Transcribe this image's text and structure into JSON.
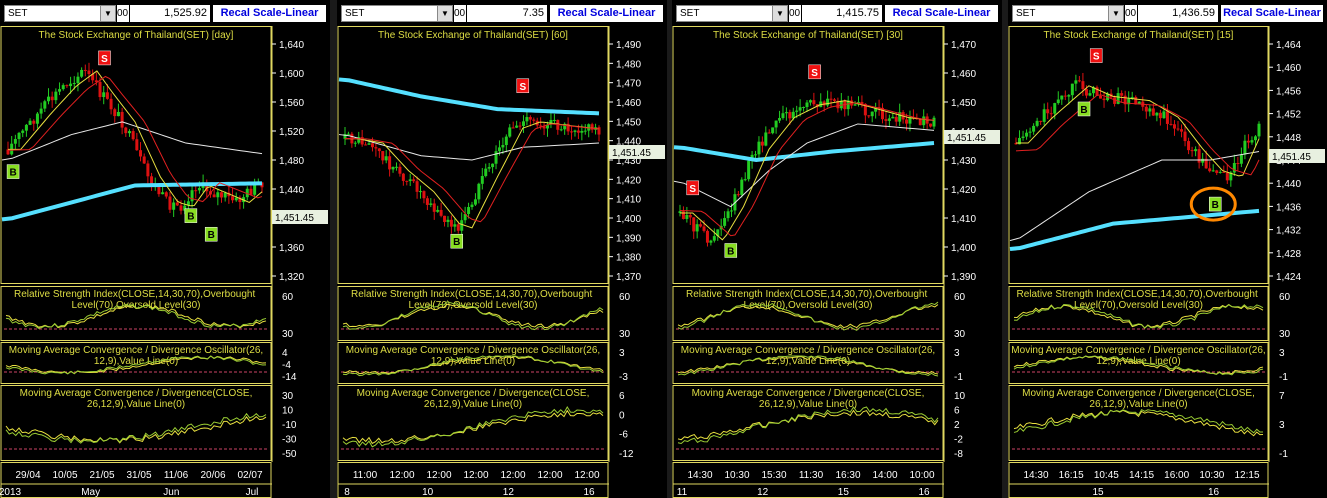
{
  "panels": [
    {
      "symbol": "SET",
      "field_small": "00",
      "price": "1,525.92",
      "scale_label": "Recal Scale-Linear",
      "title": "The Stock Exchange of Thailand(SET) [day]",
      "last_price": "1,451.45",
      "price_ticks": [
        "1,640",
        "1,600",
        "1,560",
        "1,520",
        "1,480",
        "1,440",
        "1,400",
        "1,360",
        "1,320"
      ],
      "rsi_title": "Relative Strength Index(CLOSE,14,30,70),Overbought Level(70),Oversold Level(30)",
      "rsi_ticks": [
        "60",
        "30"
      ],
      "macd_osc_title": "Moving Average Convergence / Divergence Oscillator(26,12,9),Value Line(0)",
      "macd_osc_ticks": [
        "4",
        "-4",
        "-14"
      ],
      "macd_title": "Moving Average Convergence / Divergence(CLOSE,26,12,9),Value Line(0)",
      "macd_ticks": [
        "30",
        "10",
        "-10",
        "-30",
        "-50"
      ],
      "time_labels": [
        "29/04",
        "10/05",
        "21/05",
        "31/05",
        "11/06",
        "20/06",
        "02/07"
      ],
      "bottom_labels": [
        "2013",
        "May",
        "Jun",
        "Jul"
      ],
      "signals": [
        "B",
        "B",
        "S",
        "B"
      ]
    },
    {
      "symbol": "SET",
      "field_small": "00",
      "price": "7.35",
      "scale_label": "Recal Scale-Linear",
      "title": "The Stock Exchange of Thailand(SET) [60]",
      "last_price": "1,451.45",
      "price_ticks": [
        "1,490",
        "1,480",
        "1,470",
        "1,460",
        "1,450",
        "1,440",
        "1,430",
        "1,420",
        "1,410",
        "1,400",
        "1,390",
        "1,380",
        "1,370"
      ],
      "rsi_title": "Relative Strength Index(CLOSE,14,30,70),Overbought Level(70),Oversold Level(30)",
      "rsi_ticks": [
        "60",
        "30"
      ],
      "macd_osc_title": "Moving Average Convergence / Divergence Oscillator(26,12,9),Value Line(0)",
      "macd_osc_ticks": [
        "3",
        "-3"
      ],
      "macd_title": "Moving Average Convergence / Divergence(CLOSE,26,12,9),Value Line(0)",
      "macd_ticks": [
        "6",
        "0",
        "-6",
        "-12"
      ],
      "time_labels": [
        "11:00",
        "12:00",
        "12:00",
        "12:00",
        "12:00",
        "12:00",
        "12:00"
      ],
      "bottom_labels": [
        "8",
        "10",
        "12",
        "16"
      ],
      "signals": [
        "S",
        "B"
      ]
    },
    {
      "symbol": "SET",
      "field_small": "00",
      "price": "1,415.75",
      "scale_label": "Recal Scale-Linear",
      "title": "The Stock Exchange of Thailand(SET) [30]",
      "last_price": "1,451.45",
      "price_ticks": [
        "1,470",
        "1,460",
        "1,450",
        "1,440",
        "1,430",
        "1,420",
        "1,410",
        "1,400",
        "1,390"
      ],
      "rsi_title": "Relative Strength Index(CLOSE,14,30,70),Overbought Level(70),Oversold Level(30)",
      "rsi_ticks": [
        "60",
        "30"
      ],
      "macd_osc_title": "Moving Average Convergence / Divergence Oscillator(26,12,9),Value Line(0)",
      "macd_osc_ticks": [
        "3",
        "-1"
      ],
      "macd_title": "Moving Average Convergence / Divergence(CLOSE,26,12,9),Value Line(0)",
      "macd_ticks": [
        "10",
        "6",
        "2",
        "-2",
        "-8"
      ],
      "time_labels": [
        "14:30",
        "10:30",
        "15:30",
        "11:30",
        "16:30",
        "14:00",
        "10:00"
      ],
      "bottom_labels": [
        "11",
        "12",
        "15",
        "16"
      ],
      "signals": [
        "S",
        "S",
        "B"
      ]
    },
    {
      "symbol": "SET",
      "field_small": "00",
      "price": "1,436.59",
      "scale_label": "Recal Scale-Linear",
      "title": "The Stock Exchange of Thailand(SET) [15]",
      "last_price": "1,451.45",
      "price_ticks": [
        "1,464",
        "1,460",
        "1,456",
        "1,452",
        "1,448",
        "1,444",
        "1,440",
        "1,436",
        "1,432",
        "1,428",
        "1,424"
      ],
      "rsi_title": "Relative Strength Index(CLOSE,14,30,70),Overbought Level(70),Oversold Level(30)",
      "rsi_ticks": [
        "60",
        "30"
      ],
      "macd_osc_title": "Moving Average Convergence / Divergence Oscillator(26,12,9),Value Line(0)",
      "macd_osc_ticks": [
        "3",
        "-1"
      ],
      "macd_title": "Moving Average Convergence / Divergence(CLOSE,26,12,9),Value Line(0)",
      "macd_ticks": [
        "7",
        "3",
        "-1"
      ],
      "time_labels": [
        "14:30",
        "16:15",
        "10:45",
        "14:15",
        "16:00",
        "10:30",
        "12:15"
      ],
      "bottom_labels": [
        "15",
        "16"
      ],
      "signals": [
        "S",
        "B",
        "B"
      ]
    }
  ],
  "colors": {
    "background": "#000000",
    "border": "#e0d860",
    "candle_up": "#22cc22",
    "candle_down": "#dd1111",
    "ma_long": "#55e0ff",
    "ma_white": "#e8e8e8",
    "ma_yellow": "#e8e040",
    "ma_red": "#e02020",
    "buy_signal": "#88dd22",
    "sell_signal": "#ee1111",
    "highlight_circle": "#ff8800",
    "text_title": "#dddd44",
    "text_axis": "#ffffff"
  }
}
